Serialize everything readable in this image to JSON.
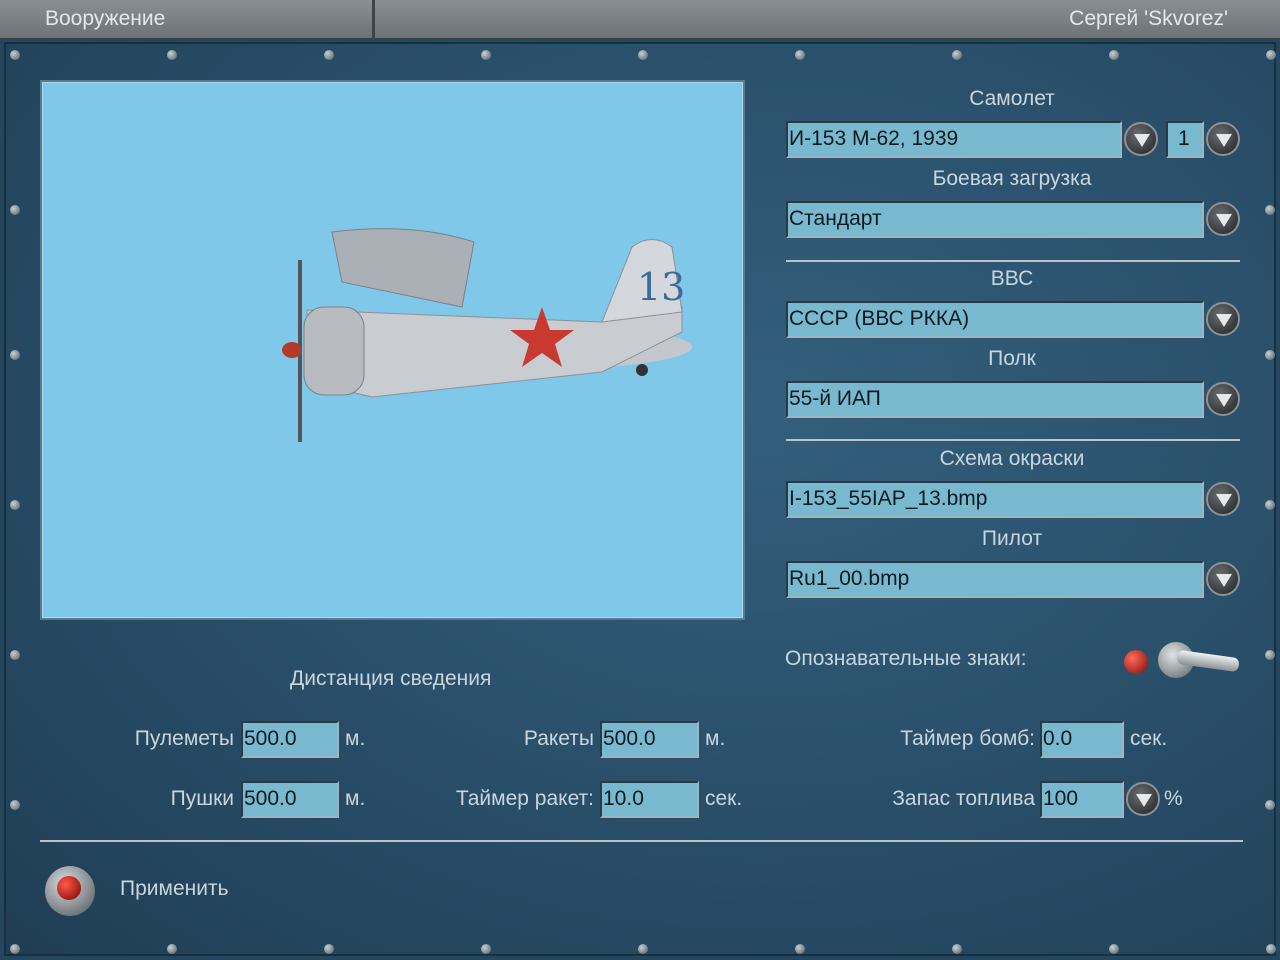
{
  "header": {
    "title": "Вооружение",
    "user": "Сергей 'Skvorez'"
  },
  "aircraft": {
    "label": "Самолет",
    "value": "И-153 М-62, 1939",
    "count": "1"
  },
  "loadout": {
    "label": "Боевая загрузка",
    "value": "Стандарт"
  },
  "airforce": {
    "label": "ВВС",
    "value": "СССР (ВВС РККА)"
  },
  "regiment": {
    "label": "Полк",
    "value": "55-й ИАП"
  },
  "skin": {
    "label": "Схема окраски",
    "value": "I-153_55IAP_13.bmp"
  },
  "pilot": {
    "label": "Пилот",
    "value": "Ru1_00.bmp"
  },
  "markings": {
    "label": "Опознавательные знаки:",
    "enabled": true
  },
  "convergence": {
    "title": "Дистанция сведения",
    "mg": {
      "label": "Пулеметы",
      "value": "500.0",
      "unit": "м."
    },
    "cannons": {
      "label": "Пушки",
      "value": "500.0",
      "unit": "м."
    },
    "rockets": {
      "label": "Ракеты",
      "value": "500.0",
      "unit": "м."
    },
    "rocket_timer": {
      "label": "Таймер ракет:",
      "value": "10.0",
      "unit": "сек."
    },
    "bomb_timer": {
      "label": "Таймер бомб:",
      "value": "0.0",
      "unit": "сек."
    },
    "fuel": {
      "label": "Запас топлива",
      "value": "100",
      "unit": "%"
    }
  },
  "apply": {
    "label": "Применить"
  },
  "preview": {
    "tail_number": "13",
    "background": "#80c8ea"
  }
}
